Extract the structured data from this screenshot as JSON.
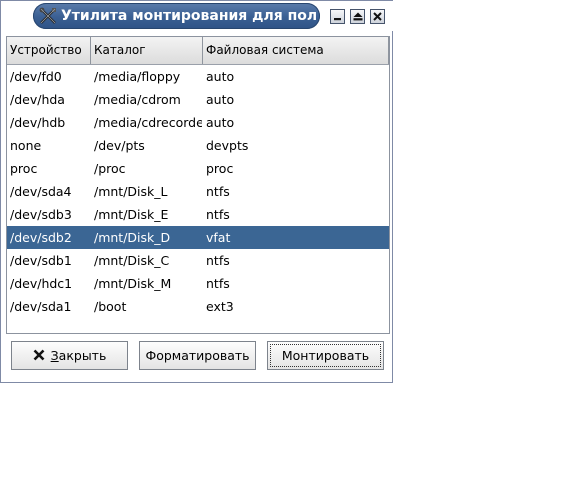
{
  "window": {
    "title": "Утилита монтирования для пользо",
    "title_icon": "tools-icon",
    "controls": {
      "minimize_icon": "minimize-icon",
      "maximize_icon": "shade-icon",
      "close_icon": "close-icon"
    }
  },
  "table": {
    "columns": [
      "Устройство",
      "Каталог",
      "Файловая система"
    ],
    "rows": [
      {
        "device": "/dev/fd0",
        "dir": "/media/floppy",
        "fs": "auto"
      },
      {
        "device": "/dev/hda",
        "dir": "/media/cdrom",
        "fs": "auto"
      },
      {
        "device": "/dev/hdb",
        "dir": "/media/cdrecorder",
        "fs": "auto"
      },
      {
        "device": "none",
        "dir": "/dev/pts",
        "fs": "devpts"
      },
      {
        "device": "proc",
        "dir": "/proc",
        "fs": "proc"
      },
      {
        "device": "/dev/sda4",
        "dir": "/mnt/Disk_L",
        "fs": "ntfs"
      },
      {
        "device": "/dev/sdb3",
        "dir": "/mnt/Disk_E",
        "fs": "ntfs"
      },
      {
        "device": "/dev/sdb2",
        "dir": "/mnt/Disk_D",
        "fs": "vfat"
      },
      {
        "device": "/dev/sdb1",
        "dir": "/mnt/Disk_C",
        "fs": "ntfs"
      },
      {
        "device": "/dev/hdc1",
        "dir": "/mnt/Disk_M",
        "fs": "ntfs"
      },
      {
        "device": "/dev/sda1",
        "dir": "/boot",
        "fs": "ext3"
      }
    ],
    "selected_row": 7
  },
  "buttons": {
    "close_label_underlined": "З",
    "close_label_rest": "акрыть",
    "close_icon": "close-x-icon",
    "format_label": "Форматировать",
    "mount_label": "Монтировать"
  },
  "colors": {
    "title_bar": "#3a5f93",
    "selection": "#3b6694"
  }
}
